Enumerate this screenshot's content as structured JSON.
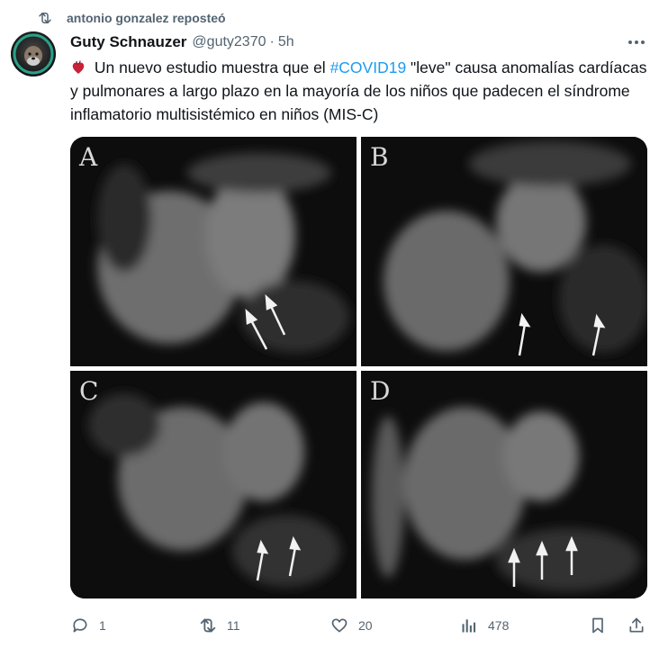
{
  "repost": {
    "icon": "repost-icon",
    "text": "antonio gonzalez reposteó"
  },
  "tweet": {
    "author_name": "Guty Schnauzer",
    "author_handle": "@guty2370",
    "separator": "·",
    "time": "5h",
    "avatar_badge_text": "LONG COVID",
    "emoji": "anatomical-heart-emoji",
    "text_part1": " Un nuevo estudio muestra que el ",
    "hashtag": "#COVID19",
    "text_part2": " \"leve\" causa anomalías cardíacas y pulmonares a largo plazo en la mayoría de los niños que padecen el síndrome inflamatorio multisistémico en niños (MIS-C)"
  },
  "media": {
    "panels": [
      {
        "letter": "A"
      },
      {
        "letter": "B"
      },
      {
        "letter": "C"
      },
      {
        "letter": "D"
      }
    ]
  },
  "actions": {
    "reply_count": "1",
    "repost_count": "11",
    "like_count": "20",
    "views_count": "478"
  },
  "colors": {
    "text_primary": "#0f1419",
    "text_secondary": "#536471",
    "link": "#1d9bf0"
  }
}
